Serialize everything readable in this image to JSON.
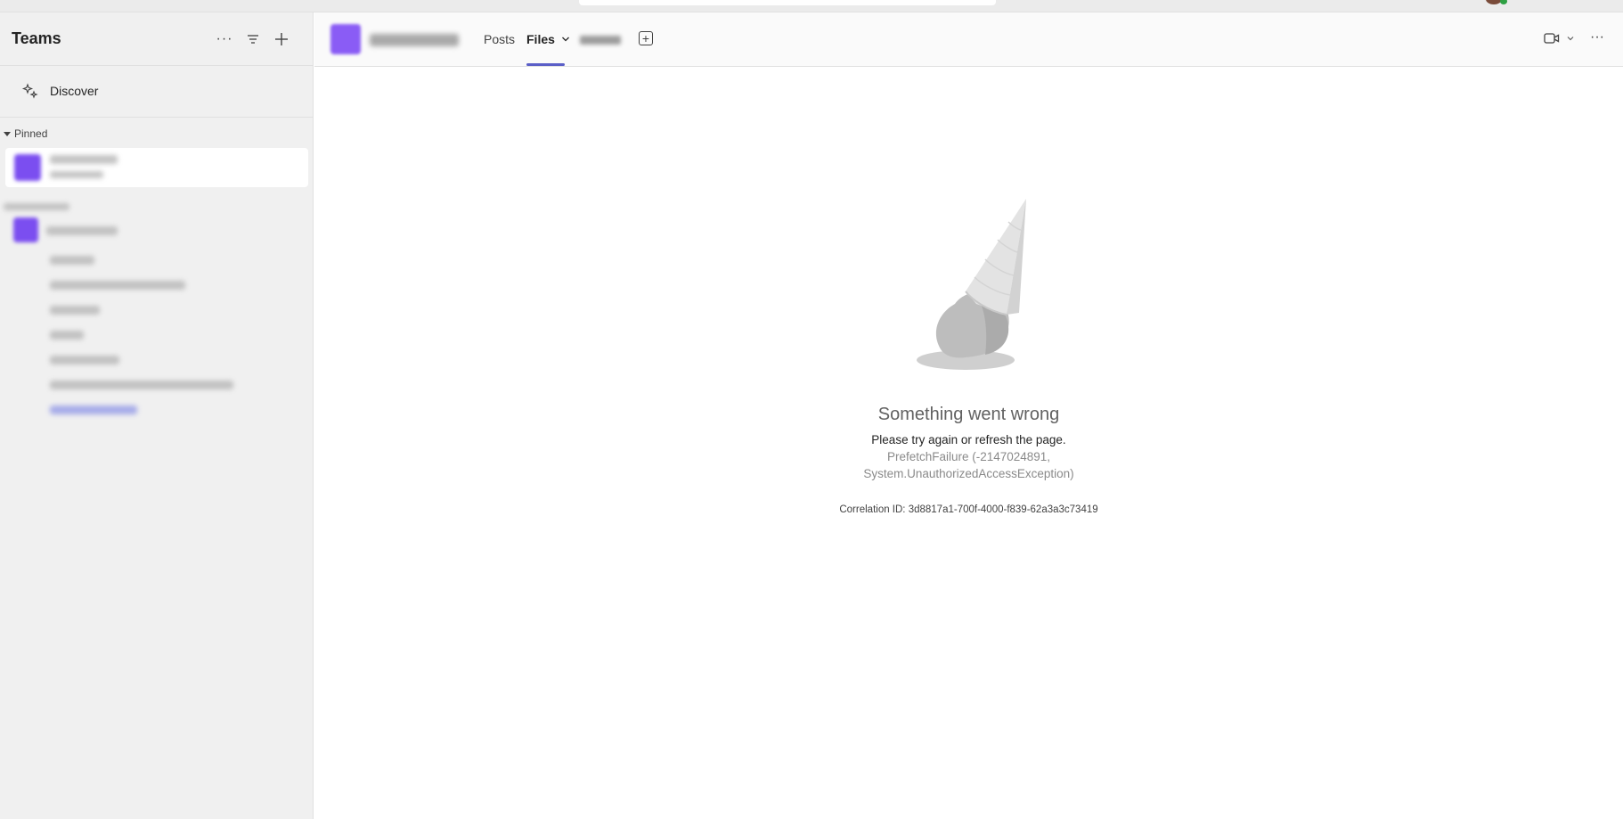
{
  "app": {
    "title": "Teams"
  },
  "sidebar": {
    "discover_label": "Discover",
    "pinned_label": "Pinned"
  },
  "channel_header": {
    "tabs": [
      {
        "label": "Posts"
      },
      {
        "label": "Files"
      }
    ],
    "more_label": "···"
  },
  "error": {
    "title": "Something went wrong",
    "subtitle": "Please try again or refresh the page.",
    "detail_line1": "PrefetchFailure (-2147024891,",
    "detail_line2": "System.UnauthorizedAccessException)",
    "correlation": "Correlation ID: 3d8817a1-700f-4000-f839-62a3a3c73419"
  },
  "colors": {
    "accent": "#5b5fc7",
    "team_avatar": "#7b4ef0",
    "sidebar_bg": "#f0f0f0"
  },
  "icons": [
    "more-icon",
    "filter-icon",
    "add-icon",
    "discover-icon",
    "chevron-down-icon",
    "add-tab-icon",
    "video-call-icon",
    "melted-ice-cream-icon"
  ]
}
